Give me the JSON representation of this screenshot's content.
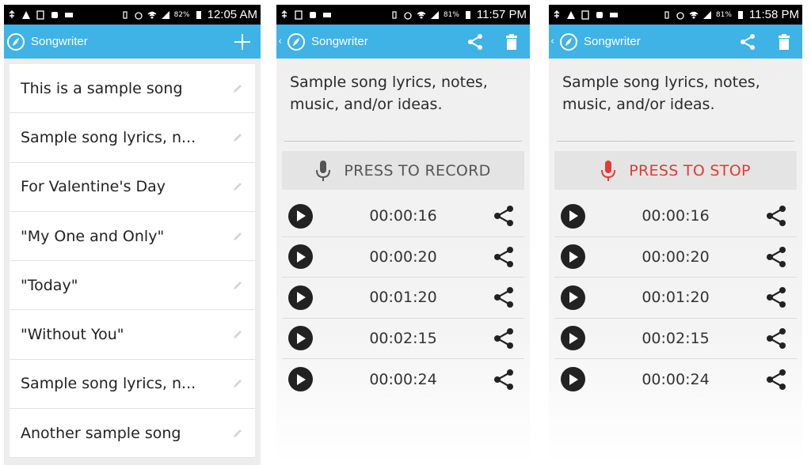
{
  "screens": [
    {
      "status": {
        "battery": "82%",
        "time": "12:05 AM"
      },
      "app_bar": {
        "title": "Songwriter",
        "action_icon": "plus-icon"
      },
      "songs": [
        {
          "title": "This is a sample song"
        },
        {
          "title": "Sample song lyrics, n..."
        },
        {
          "title": "For Valentine's Day"
        },
        {
          "title": "\"My One and Only\""
        },
        {
          "title": "\"Today\""
        },
        {
          "title": "\"Without You\""
        },
        {
          "title": "Sample song lyrics, n..."
        },
        {
          "title": "Another sample song"
        }
      ]
    },
    {
      "status": {
        "battery": "81%",
        "time": "11:57 PM"
      },
      "app_bar": {
        "title": "Songwriter",
        "action_icons": [
          "share-icon",
          "trash-icon"
        ]
      },
      "lyrics": "Sample song lyrics, notes, music, and/or ideas.",
      "record_button": {
        "label": "PRESS TO RECORD",
        "color": "#555555"
      },
      "recordings": [
        {
          "duration": "00:00:16"
        },
        {
          "duration": "00:00:20"
        },
        {
          "duration": "00:01:20"
        },
        {
          "duration": "00:02:15"
        },
        {
          "duration": "00:00:24"
        }
      ]
    },
    {
      "status": {
        "battery": "81%",
        "time": "11:58 PM"
      },
      "app_bar": {
        "title": "Songwriter",
        "action_icons": [
          "share-icon",
          "trash-icon"
        ]
      },
      "lyrics": "Sample song lyrics, notes, music, and/or ideas.",
      "record_button": {
        "label": "PRESS TO STOP",
        "color": "#e53935"
      },
      "recordings": [
        {
          "duration": "00:00:16"
        },
        {
          "duration": "00:00:20"
        },
        {
          "duration": "00:01:20"
        },
        {
          "duration": "00:02:15"
        },
        {
          "duration": "00:00:24"
        }
      ]
    }
  ],
  "colors": {
    "app_bar": "#3fb2e6",
    "stop_red": "#e53935",
    "status_bar": "#000000"
  }
}
